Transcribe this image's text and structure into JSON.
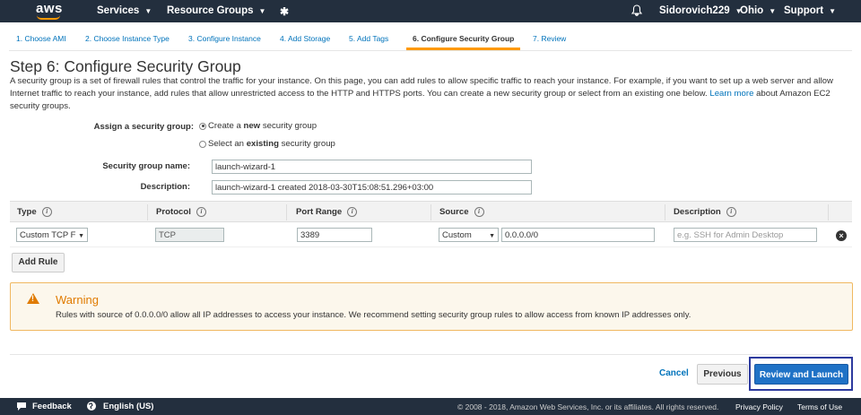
{
  "topnav": {
    "logo": "aws",
    "services": "Services",
    "resource_groups": "Resource Groups",
    "pin_icon": "pin-icon",
    "bell_icon": "bell-icon",
    "account": "Sidorovich229",
    "region": "Ohio",
    "support": "Support"
  },
  "tabs": [
    {
      "label": "1. Choose AMI"
    },
    {
      "label": "2. Choose Instance Type"
    },
    {
      "label": "3. Configure Instance"
    },
    {
      "label": "4. Add Storage"
    },
    {
      "label": "5. Add Tags"
    },
    {
      "label": "6. Configure Security Group",
      "active": true
    },
    {
      "label": "7. Review"
    }
  ],
  "page": {
    "title": "Step 6: Configure Security Group",
    "intro_part1": "A security group is a set of firewall rules that control the traffic for your instance. On this page, you can add rules to allow specific traffic to reach your instance. For example, if you want to set up a web server and allow Internet traffic to reach your instance, add rules that allow unrestricted access to the HTTP and HTTPS ports. You can create a new security group or select from an existing one below.",
    "learn_more": "Learn more",
    "intro_part2": "about Amazon EC2 security groups."
  },
  "form": {
    "assign_label": "Assign a security group:",
    "radio_create_prefix": "Create a",
    "radio_create_bold": "new",
    "radio_create_suffix": "security group",
    "radio_create_selected": true,
    "radio_select_prefix": "Select an",
    "radio_select_bold": "existing",
    "radio_select_suffix": "security group",
    "radio_select_selected": false,
    "name_label": "Security group name:",
    "name_value": "launch-wizard-1",
    "desc_label": "Description:",
    "desc_value": "launch-wizard-1 created 2018-03-30T15:08:51.296+03:00"
  },
  "rules_table": {
    "columns": [
      "Type",
      "Protocol",
      "Port Range",
      "Source",
      "Description"
    ],
    "info_glyph": "i",
    "rows": [
      {
        "type": "Custom TCP F",
        "protocol": "TCP",
        "port_range": "3389",
        "source_type": "Custom",
        "source_value": "0.0.0.0/0",
        "description_placeholder": "e.g. SSH for Admin Desktop"
      }
    ],
    "add_rule": "Add Rule"
  },
  "warning": {
    "title": "Warning",
    "text": "Rules with source of 0.0.0.0/0 allow all IP addresses to access your instance. We recommend setting security group rules to allow access from known IP addresses only."
  },
  "actions": {
    "cancel": "Cancel",
    "previous": "Previous",
    "review_launch": "Review and Launch"
  },
  "footer": {
    "feedback": "Feedback",
    "language": "English (US)",
    "copyright": "© 2008 - 2018, Amazon Web Services, Inc. or its affiliates. All rights reserved.",
    "privacy": "Privacy Policy",
    "terms": "Terms of Use"
  },
  "colors": {
    "nav_bg": "#232f3e",
    "accent": "#ff9900",
    "link": "#0073bb",
    "primary_button": "#1f72c6",
    "warning": "#e07b00"
  }
}
